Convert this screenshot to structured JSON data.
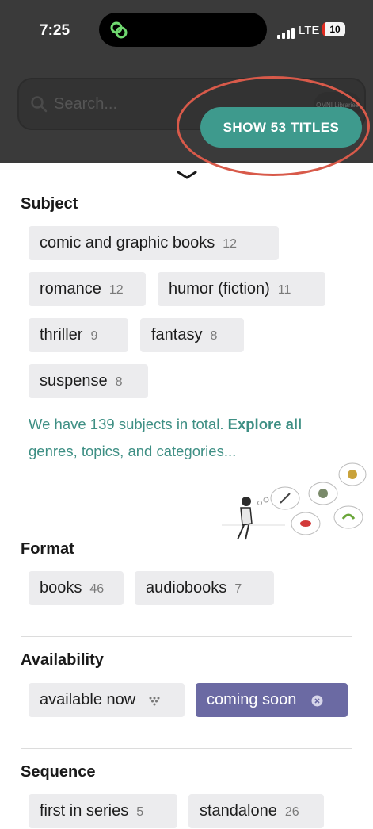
{
  "status_bar": {
    "time": "7:25",
    "network": "LTE",
    "battery": "10"
  },
  "search": {
    "placeholder": "Search...",
    "logo_text": "OMNI Libraries"
  },
  "show_button": {
    "label": "SHOW 53 TITLES"
  },
  "subject": {
    "title": "Subject",
    "chips": [
      {
        "label": "comic and graphic books",
        "count": "12"
      },
      {
        "label": "romance",
        "count": "12"
      },
      {
        "label": "humor (fiction)",
        "count": "11"
      },
      {
        "label": "thriller",
        "count": "9"
      },
      {
        "label": "fantasy",
        "count": "8"
      },
      {
        "label": "suspense",
        "count": "8"
      }
    ],
    "note_text": "We have 139 subjects in total.",
    "note_link": "Explore all",
    "note_text2": "genres, topics, and categories..."
  },
  "format": {
    "title": "Format",
    "chips": [
      {
        "label": "books",
        "count": "46"
      },
      {
        "label": "audiobooks",
        "count": "7"
      }
    ]
  },
  "availability": {
    "title": "Availability",
    "chips": [
      {
        "label": "available now"
      },
      {
        "label": "coming soon",
        "selected": true
      }
    ]
  },
  "sequence": {
    "title": "Sequence",
    "chips": [
      {
        "label": "first in series",
        "count": "5"
      },
      {
        "label": "standalone",
        "count": "26"
      }
    ]
  },
  "colors": {
    "accent": "#3e9a8d",
    "selected_chip": "#6b6aa3",
    "ring": "#d85a4a"
  }
}
